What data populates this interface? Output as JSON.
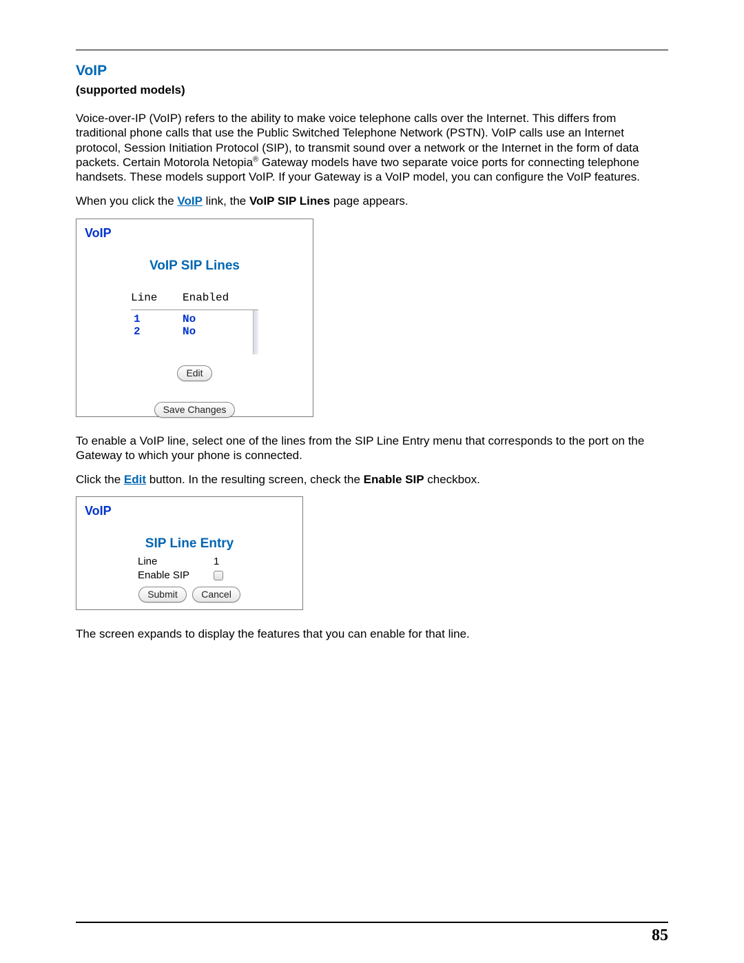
{
  "heading": "VoIP",
  "subheading": "(supported models)",
  "para1_part1": "Voice-over-IP (VoIP) refers to the ability to make voice telephone calls over the Internet. This differs from traditional phone calls that use the Public Switched Telephone Network (PSTN). VoIP calls use an Internet protocol, Session Initiation Protocol (SIP), to transmit sound over a network or the Internet in the form of data packets. Certain Motorola Netopia",
  "para1_reg": "®",
  "para1_part2": " Gateway models have two separate voice ports for connecting telephone handsets. These models support VoIP. If your Gateway is a VoIP model, you can configure the VoIP features.",
  "para2_pre": "When you click the ",
  "para2_link": "VoIP",
  "para2_mid": " link, the ",
  "para2_bold": "VoIP SIP Lines",
  "para2_post": " page appears.",
  "panel1": {
    "title": "VoIP",
    "subtitle": "VoIP SIP Lines",
    "header_line": "Line",
    "header_enabled": "Enabled",
    "rows": [
      {
        "line": "1",
        "enabled": "No"
      },
      {
        "line": "2",
        "enabled": "No"
      }
    ],
    "edit_btn": "Edit",
    "save_btn": "Save Changes"
  },
  "para3": "To enable a VoIP line, select one of the lines from the SIP Line Entry menu that corresponds to the port on the Gateway to which your phone is connected.",
  "para4_pre": "Click the ",
  "para4_link": "Edit",
  "para4_mid": " button. In the resulting screen, check the ",
  "para4_bold": "Enable SIP",
  "para4_post": " checkbox.",
  "panel2": {
    "title": "VoIP",
    "subtitle": "SIP Line Entry",
    "line_label": "Line",
    "line_value": "1",
    "enable_label": "Enable SIP",
    "submit_btn": "Submit",
    "cancel_btn": "Cancel"
  },
  "para5": "The screen expands to display the features that you can enable for that line.",
  "page_number": "85"
}
